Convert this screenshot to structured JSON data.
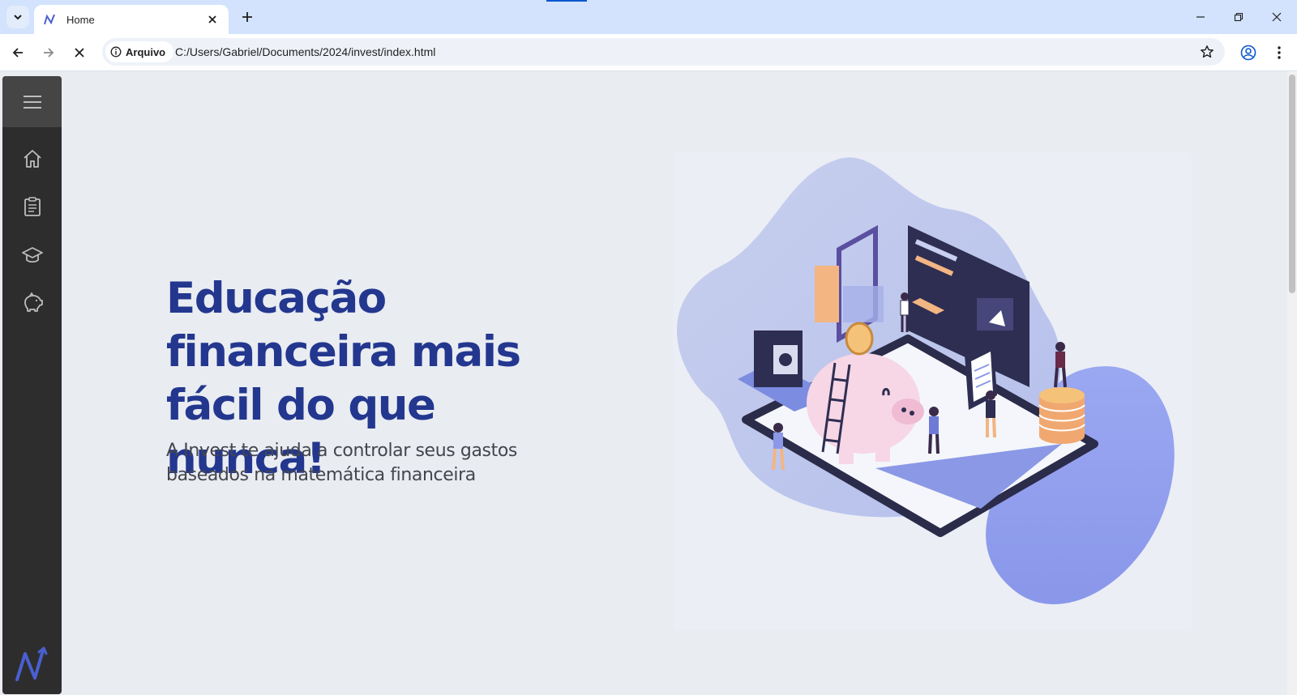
{
  "browser": {
    "tab": {
      "title": "Home",
      "favicon": "invest-logo-icon"
    },
    "new_tab_icon": "plus-icon",
    "window_controls": [
      "minimize-icon",
      "restore-icon",
      "close-icon"
    ],
    "nav": {
      "back_icon": "arrow-left-icon",
      "forward_icon": "arrow-right-icon",
      "stop_icon": "close-icon"
    },
    "address": {
      "security_label": "Arquivo",
      "url": "C:/Users/Gabriel/Documents/2024/invest/index.html"
    },
    "right_icons": [
      "star-icon",
      "profile-icon",
      "kebab-menu-icon"
    ]
  },
  "sidebar": {
    "menu_icon": "hamburger-icon",
    "items": [
      {
        "icon": "home-icon"
      },
      {
        "icon": "clipboard-icon"
      },
      {
        "icon": "graduation-cap-icon"
      },
      {
        "icon": "piggy-bank-icon"
      }
    ],
    "logo": "invest-logo-icon"
  },
  "hero": {
    "title": "Educação financeira mais fácil do que nunca!",
    "subtitle": "A Invest te ajuda a controlar seus gastos baseados na matemática financeira"
  },
  "colors": {
    "title": "#23378f",
    "subtitle": "#44464d",
    "sidebar": "#2d2d2d",
    "accent": "#8d9df0",
    "page_bg": "#e9ecf1"
  }
}
